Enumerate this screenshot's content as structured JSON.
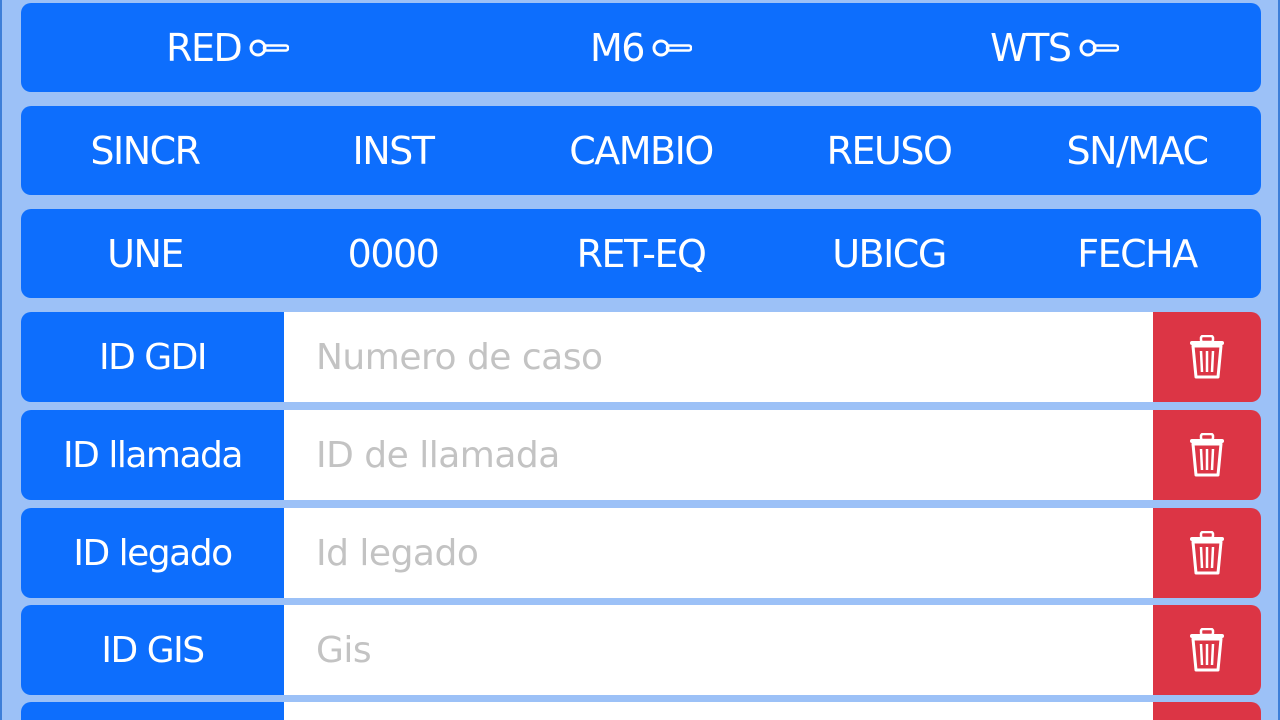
{
  "top_bar": {
    "items": [
      {
        "label": "RED",
        "icon": "key-icon"
      },
      {
        "label": "M6",
        "icon": "key-icon"
      },
      {
        "label": "WTS",
        "icon": "key-icon"
      }
    ]
  },
  "actions_row_1": [
    "SINCR",
    "INST",
    "CAMBIO",
    "REUSO",
    "SN/MAC"
  ],
  "actions_row_2": [
    "UNE",
    "0000",
    "RET-EQ",
    "UBICG",
    "FECHA"
  ],
  "fields": [
    {
      "label": "ID GDI",
      "placeholder": "Numero de caso",
      "value": ""
    },
    {
      "label": "ID llamada",
      "placeholder": "ID de llamada",
      "value": ""
    },
    {
      "label": "ID legado",
      "placeholder": "Id legado",
      "value": ""
    },
    {
      "label": "ID GIS",
      "placeholder": "Gis",
      "value": ""
    }
  ],
  "delete_icon": "trash-icon",
  "colors": {
    "primary": "#0d6efd",
    "danger": "#dc3545",
    "background": "#9cc1f7",
    "placeholder": "#c3c3c3"
  }
}
